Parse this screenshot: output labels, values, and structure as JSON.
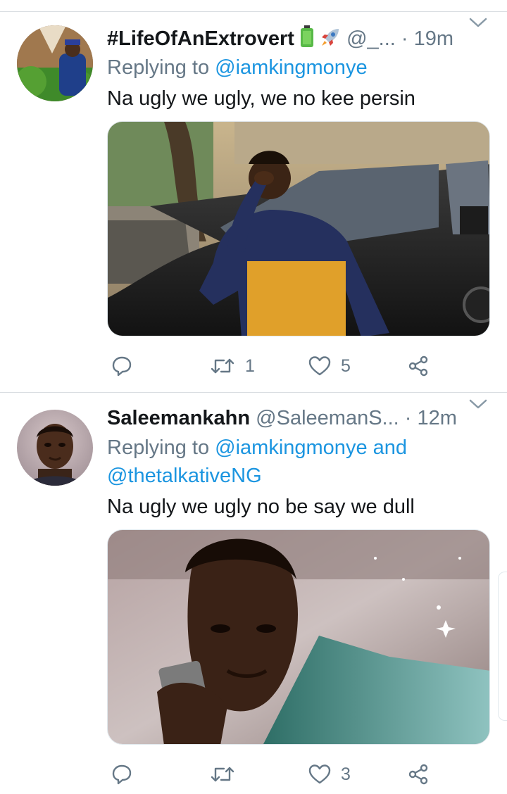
{
  "tweets": [
    {
      "name": "#LifeOfAnExtrovert",
      "handle": "@_...",
      "time": "· 19m",
      "replying_prefix": "Replying to ",
      "mentions": [
        "@iamkingmonye"
      ],
      "mentions_joiner": "",
      "text": "Na ugly we ugly, we no kee persin",
      "emojis": [
        "battery-icon",
        "rocket-icon"
      ],
      "media_description": "Photo",
      "actions": {
        "reply_count": "",
        "retweet_count": "1",
        "like_count": "5"
      }
    },
    {
      "name": "Saleemankahn",
      "handle": "@SaleemanS...",
      "time": "· 12m",
      "replying_prefix": "Replying to ",
      "mentions": [
        "@iamkingmonye",
        "@thetalkativeNG"
      ],
      "mentions_joiner": " and",
      "text": "Na ugly we ugly no be say we dull",
      "media_description": "Photo",
      "actions": {
        "reply_count": "",
        "retweet_count": "",
        "like_count": "3"
      }
    }
  ],
  "colors": {
    "accent": "#1b95e0",
    "secondary_text": "#657786",
    "divider": "#d9dde1"
  }
}
